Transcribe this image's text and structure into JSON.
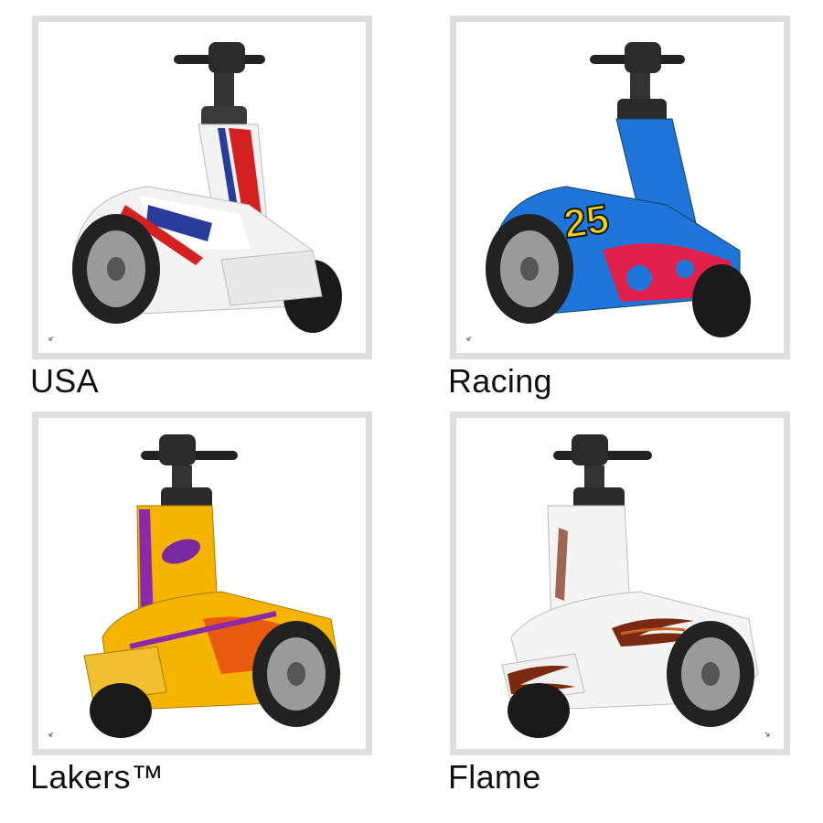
{
  "gallery": {
    "items": [
      {
        "label": "USA",
        "theme": "usa",
        "body_color": "#f2f2f2",
        "accent_color": "#d42020",
        "stripe_color": "#2a3c9a"
      },
      {
        "label": "Racing",
        "theme": "racing",
        "body_color": "#1e74d8",
        "accent_color": "#e0204a",
        "stripe_color": "#f2d20a"
      },
      {
        "label": "Lakers™",
        "theme": "lakers",
        "body_color": "#f4b400",
        "accent_color": "#8a2aa8",
        "stripe_color": "#e85a10"
      },
      {
        "label": "Flame",
        "theme": "flame",
        "body_color": "#f4f4f4",
        "accent_color": "#7a2a10",
        "stripe_color": "#c86020"
      }
    ],
    "zoom_icon": "magnify-expand-icon"
  }
}
